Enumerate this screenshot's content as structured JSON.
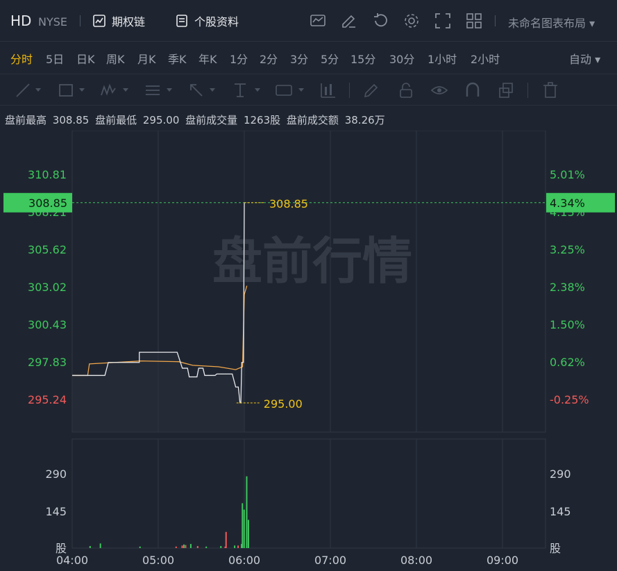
{
  "header": {
    "symbol": "HD",
    "exchange": "NYSE",
    "options_chain_label": "期权链",
    "profile_label": "个股资料",
    "layout_label": "未命名图表布局"
  },
  "periods": {
    "items": [
      "分时",
      "5日",
      "日K",
      "周K",
      "月K",
      "季K",
      "年K",
      "1分",
      "2分",
      "3分",
      "5分",
      "15分",
      "30分",
      "1小时",
      "2小时"
    ],
    "active_index": 0,
    "auto_label": "自动"
  },
  "info": {
    "high_label": "盘前最高",
    "high": "308.85",
    "low_label": "盘前最低",
    "low": "295.00",
    "volume_label": "盘前成交量",
    "volume": "1263股",
    "turnover_label": "盘前成交额",
    "turnover": "38.26万"
  },
  "colors": {
    "up": "#3ec85e",
    "down": "#f25a5a",
    "price_line": "#e8eaed",
    "avg_line": "#f0a64a",
    "marker": "#f0c419",
    "accent_active": "#f0b90b"
  },
  "chart_data": {
    "type": "line",
    "watermark": "盘前行情",
    "x_ticks": [
      "04:00",
      "05:00",
      "06:00",
      "07:00",
      "08:00",
      "09:00"
    ],
    "price_ticks": [
      "310.81",
      "308.21",
      "305.62",
      "303.02",
      "300.43",
      "297.83",
      "295.24"
    ],
    "pct_ticks": [
      "5.01%",
      "4.13%",
      "3.25%",
      "2.38%",
      "1.50%",
      "0.62%",
      "-0.25%"
    ],
    "current_price_tag": "308.85",
    "current_pct_tag": "4.34%",
    "high_marker": "308.85",
    "low_marker": "295.00",
    "volume_ticks": [
      "290",
      "145",
      "股"
    ],
    "volume_ticks_right": [
      "290",
      "145",
      "股"
    ],
    "ylim": [
      295.24,
      310.81
    ],
    "price_series": [
      [
        0,
        296.9
      ],
      [
        0.38,
        296.9
      ],
      [
        0.42,
        297.8
      ],
      [
        0.78,
        297.8
      ],
      [
        0.78,
        298.5
      ],
      [
        1.22,
        298.5
      ],
      [
        1.28,
        297.4
      ],
      [
        1.34,
        297.4
      ],
      [
        1.36,
        296.8
      ],
      [
        1.45,
        296.8
      ],
      [
        1.47,
        297.4
      ],
      [
        1.52,
        297.4
      ],
      [
        1.54,
        296.9
      ],
      [
        1.66,
        296.9
      ],
      [
        1.68,
        297.0
      ],
      [
        1.86,
        297.0
      ],
      [
        1.9,
        296.1
      ],
      [
        1.93,
        296.1
      ],
      [
        1.95,
        295.0
      ],
      [
        1.96,
        295.0
      ],
      [
        1.97,
        297.8
      ],
      [
        1.99,
        297.8
      ],
      [
        2.0,
        308.85
      ],
      [
        2.01,
        308.85
      ]
    ],
    "avg_series": [
      [
        0,
        296.9
      ],
      [
        0.18,
        296.9
      ],
      [
        0.2,
        297.7
      ],
      [
        0.5,
        297.8
      ],
      [
        0.8,
        297.9
      ],
      [
        1.24,
        297.85
      ],
      [
        1.4,
        297.6
      ],
      [
        1.7,
        297.5
      ],
      [
        1.9,
        297.3
      ],
      [
        1.98,
        297.5
      ],
      [
        2.0,
        302.5
      ],
      [
        2.03,
        303.1
      ]
    ],
    "volume_series": [
      [
        0.2,
        8,
        "up"
      ],
      [
        0.32,
        18,
        "up"
      ],
      [
        0.78,
        6,
        "up"
      ],
      [
        1.2,
        6,
        "down"
      ],
      [
        1.27,
        10,
        "down"
      ],
      [
        1.29,
        14,
        "up"
      ],
      [
        1.31,
        12,
        "down"
      ],
      [
        1.37,
        16,
        "up"
      ],
      [
        1.45,
        8,
        "down"
      ],
      [
        1.55,
        6,
        "up"
      ],
      [
        1.72,
        8,
        "up"
      ],
      [
        1.77,
        6,
        "down"
      ],
      [
        1.78,
        63,
        "down"
      ],
      [
        1.88,
        10,
        "up"
      ],
      [
        1.92,
        10,
        "down"
      ],
      [
        1.96,
        16,
        "up"
      ],
      [
        1.97,
        175,
        "up"
      ],
      [
        1.99,
        150,
        "up"
      ],
      [
        2.02,
        280,
        "up"
      ],
      [
        2.04,
        110,
        "up"
      ]
    ],
    "volume_max": 290
  }
}
